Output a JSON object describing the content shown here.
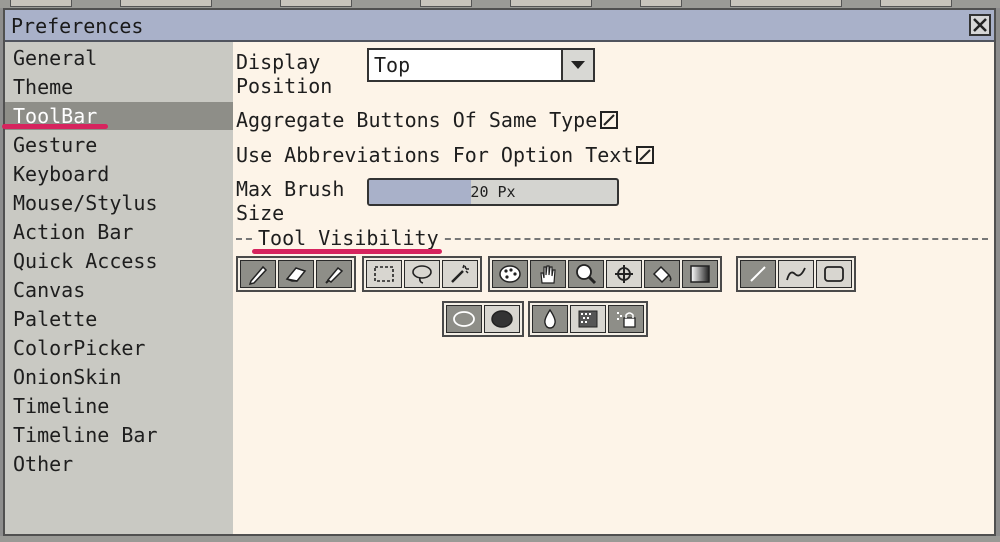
{
  "window": {
    "title": "Preferences",
    "close_icon": "close-icon"
  },
  "sidebar": {
    "active_index": 2,
    "items": [
      {
        "label": "General"
      },
      {
        "label": "Theme"
      },
      {
        "label": "ToolBar"
      },
      {
        "label": "Gesture"
      },
      {
        "label": "Keyboard"
      },
      {
        "label": "Mouse/Stylus"
      },
      {
        "label": "Action Bar"
      },
      {
        "label": "Quick Access"
      },
      {
        "label": "Canvas"
      },
      {
        "label": "Palette"
      },
      {
        "label": "ColorPicker"
      },
      {
        "label": "OnionSkin"
      },
      {
        "label": "Timeline"
      },
      {
        "label": "Timeline Bar"
      },
      {
        "label": "Other"
      }
    ]
  },
  "settings": {
    "display_position": {
      "label_line1": "Display",
      "label_line2": "Position",
      "value": "Top"
    },
    "aggregate": {
      "label": "Aggregate Buttons Of Same Type",
      "checked": true
    },
    "abbreviations": {
      "label": "Use Abbreviations For Option Text",
      "checked": true
    },
    "max_brush": {
      "label_line1": "Max Brush",
      "label_line2": "Size",
      "value_text": "20 Px",
      "fraction": 0.41
    },
    "tool_visibility_label": "Tool Visibility"
  },
  "colors": {
    "accent_bar": "#a9b1c9",
    "sidebar_bg": "#c9c9c3",
    "active_item": "#8e8e88",
    "panel_bg": "#fdf4e8",
    "annotation": "#d6245e"
  },
  "tool_groups": [
    {
      "tools": [
        {
          "icon": "pencil-icon",
          "on": true
        },
        {
          "icon": "eraser-icon",
          "on": true
        },
        {
          "icon": "brush-icon",
          "on": true
        }
      ]
    },
    {
      "tools": [
        {
          "icon": "rect-select-icon",
          "on": false
        },
        {
          "icon": "lasso-icon",
          "on": false
        },
        {
          "icon": "magic-wand-icon",
          "on": false
        }
      ]
    },
    {
      "tools": [
        {
          "icon": "palette-icon",
          "on": true
        },
        {
          "icon": "hand-icon",
          "on": true
        },
        {
          "icon": "zoom-icon",
          "on": true
        },
        {
          "icon": "move-icon",
          "on": false
        },
        {
          "icon": "fill-icon",
          "on": true
        },
        {
          "icon": "gradient-icon",
          "on": true
        }
      ]
    },
    {
      "tools": [
        {
          "icon": "line-icon",
          "on": true
        },
        {
          "icon": "curve-icon",
          "on": false
        },
        {
          "icon": "rectangle-icon",
          "on": false
        }
      ]
    },
    {
      "tools": [
        {
          "icon": "ellipse-icon",
          "on": true
        },
        {
          "icon": "filled-ellipse-icon",
          "on": false
        }
      ]
    },
    {
      "tools": [
        {
          "icon": "drop-icon",
          "on": true
        },
        {
          "icon": "dither-icon",
          "on": false
        },
        {
          "icon": "lock-icon",
          "on": true
        }
      ]
    }
  ]
}
